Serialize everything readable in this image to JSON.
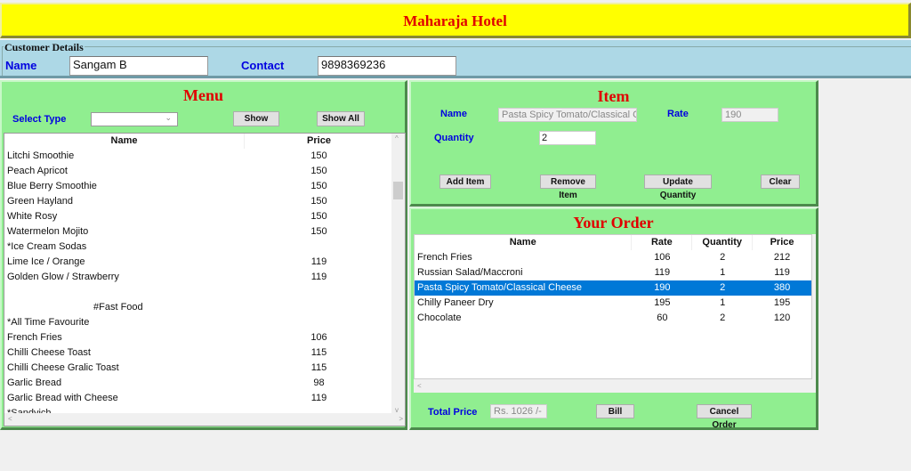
{
  "app": {
    "title": "Maharaja Hotel"
  },
  "customer": {
    "legend": "Customer Details",
    "name_label": "Name",
    "name_value": "Sangam B",
    "contact_label": "Contact",
    "contact_value": "9898369236"
  },
  "menu": {
    "title": "Menu",
    "select_type_label": "Select Type",
    "select_type_value": "",
    "show_button": "Show",
    "show_all_button": "Show All",
    "columns": [
      "Name",
      "Price"
    ],
    "rows": [
      {
        "name": "Litchi Smoothie",
        "price": "150"
      },
      {
        "name": "Peach Apricot",
        "price": "150"
      },
      {
        "name": "Blue Berry Smoothie",
        "price": "150"
      },
      {
        "name": "Green Hayland",
        "price": "150"
      },
      {
        "name": "White Rosy",
        "price": "150"
      },
      {
        "name": "Watermelon Mojito",
        "price": "150"
      },
      {
        "name": "*Ice Cream Sodas",
        "price": ""
      },
      {
        "name": "Lime Ice / Orange",
        "price": "119"
      },
      {
        "name": "Golden Glow / Strawberry",
        "price": "119"
      },
      {
        "name": "",
        "price": ""
      },
      {
        "name": "#Fast Food",
        "price": "",
        "section": true
      },
      {
        "name": "*All Time Favourite",
        "price": ""
      },
      {
        "name": "French Fries",
        "price": "106"
      },
      {
        "name": "Chilli Cheese Toast",
        "price": "115"
      },
      {
        "name": "Chilli Cheese Gralic Toast",
        "price": "115"
      },
      {
        "name": "Garlic Bread",
        "price": "98"
      },
      {
        "name": "Garlic Bread with Cheese",
        "price": "119"
      },
      {
        "name": "*Sandvich",
        "price": ""
      }
    ]
  },
  "item": {
    "title": "Item",
    "name_label": "Name",
    "name_value": "Pasta Spicy Tomato/Classical C",
    "rate_label": "Rate",
    "rate_value": "190",
    "quantity_label": "Quantity",
    "quantity_value": "2",
    "add_button": "Add Item",
    "remove_button": "Remove Item",
    "update_button": "Update Quantity",
    "clear_button": "Clear"
  },
  "order": {
    "title": "Your Order",
    "columns": [
      "Name",
      "Rate",
      "Quantity",
      "Price"
    ],
    "rows": [
      {
        "name": "French Fries",
        "rate": "106",
        "qty": "2",
        "price": "212",
        "selected": false
      },
      {
        "name": "Russian Salad/Maccroni",
        "rate": "119",
        "qty": "1",
        "price": "119",
        "selected": false
      },
      {
        "name": "Pasta Spicy Tomato/Classical Cheese",
        "rate": "190",
        "qty": "2",
        "price": "380",
        "selected": true
      },
      {
        "name": "Chilly Paneer Dry",
        "rate": "195",
        "qty": "1",
        "price": "195",
        "selected": false
      },
      {
        "name": "Chocolate",
        "rate": "60",
        "qty": "2",
        "price": "120",
        "selected": false
      }
    ],
    "total_label": "Total Price",
    "total_value": "Rs. 1026  /-",
    "bill_button": "Bill",
    "cancel_button": "Cancel Order"
  },
  "icons": {
    "chevron_down": "⌄",
    "scroll_up": "^",
    "scroll_down": "v",
    "scroll_left": "<",
    "scroll_right": ">"
  },
  "colors": {
    "title_bg": "#ffff00",
    "title_text": "#e00000",
    "customer_bg": "#add8e6",
    "panel_bg": "#90ee90",
    "label_blue": "#0000e0",
    "selection": "#0078d7"
  }
}
